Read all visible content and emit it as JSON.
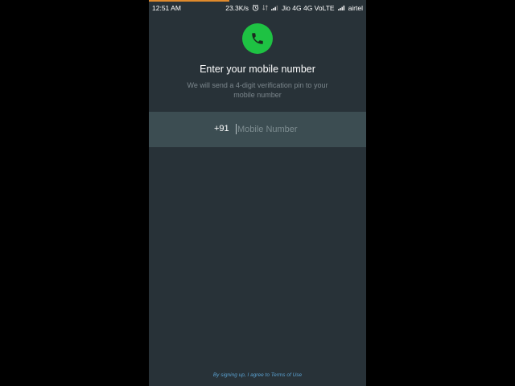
{
  "status_bar": {
    "time": "12:51 AM",
    "speed": "23.3K/s",
    "network": "Jio 4G 4G VoLTE",
    "carrier": "airtel"
  },
  "header": {
    "icon": "phone-icon",
    "title": "Enter your mobile number",
    "subtitle_line1": "We will send a 4-digit verification pin to your",
    "subtitle_line2": "mobile number"
  },
  "phone_input": {
    "country_code": "+91",
    "value": "",
    "placeholder": "Mobile Number"
  },
  "footer": {
    "terms_text": "By signing up, I agree to Terms of Use"
  },
  "colors": {
    "background": "#283238",
    "input_band": "#3c4d52",
    "accent_green": "#1ec243",
    "link_blue": "#5aa0cf",
    "progress_orange": "#e08a2c"
  }
}
